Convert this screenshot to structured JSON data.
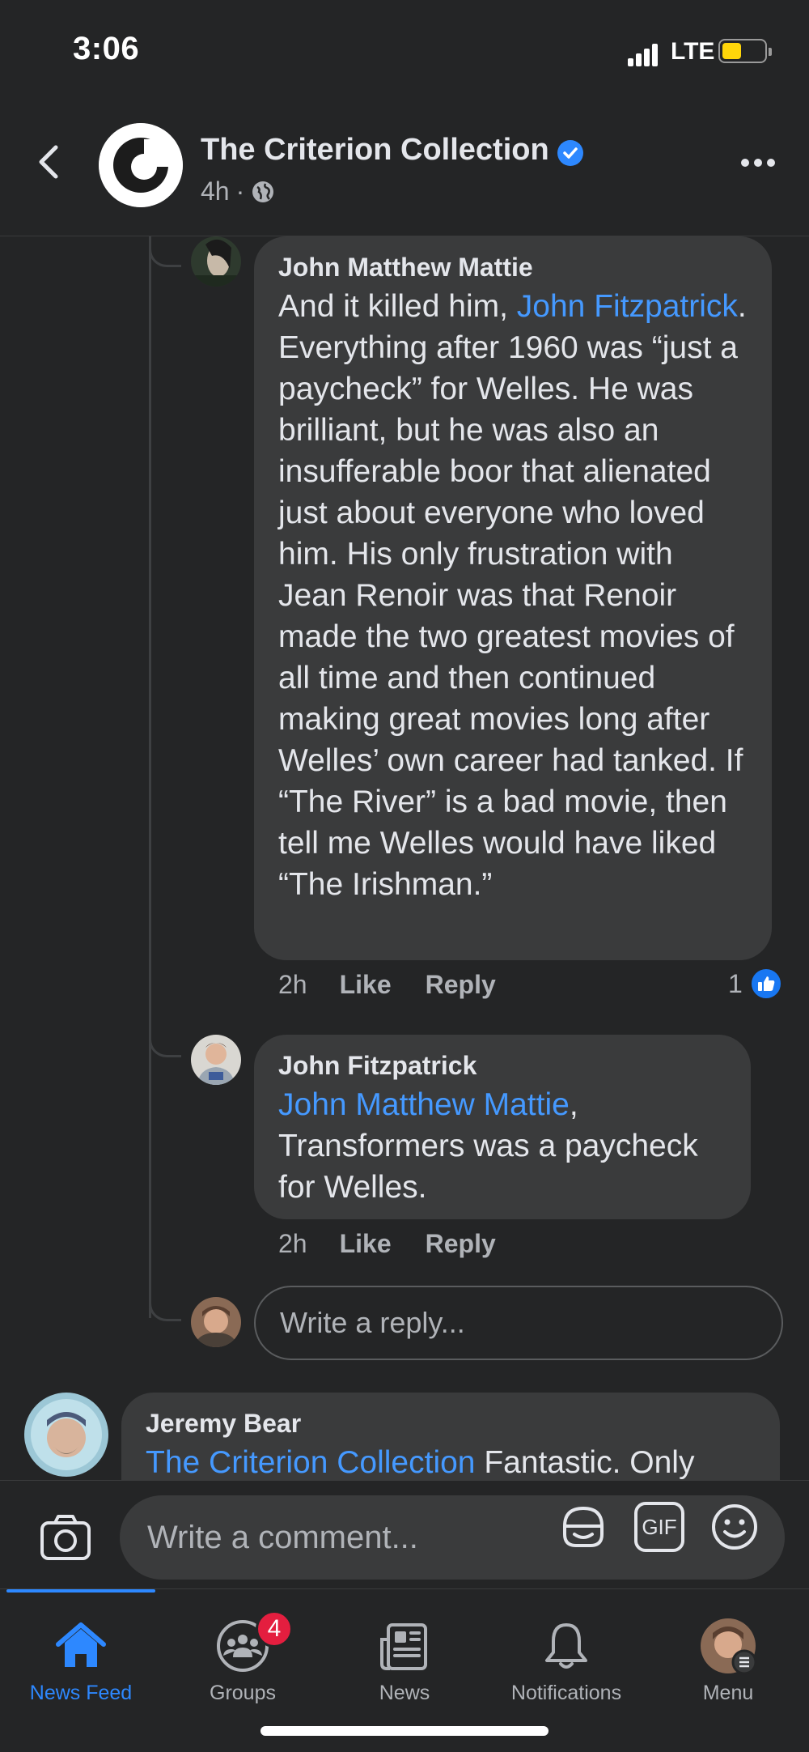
{
  "status_bar": {
    "time": "3:06",
    "network": "LTE",
    "battery_color": "#ffd60a"
  },
  "header": {
    "page_name": "The Criterion Collection",
    "time_ago": "4h",
    "separator": "·",
    "verified_icon": "verified-check-icon",
    "privacy_icon": "globe-icon"
  },
  "comments": [
    {
      "author": "John Matthew Mattie",
      "body_pre": "And it killed him, ",
      "mention": "John Fitzpatrick",
      "body_post": ". Everything after 1960 was “just a paycheck” for Welles. He was brilliant, but he was also an insufferable boor that alienated just about everyone who loved him. His only frustration with Jean Renoir was that Renoir made the two greatest movies of all time and then continued making great movies long after Welles’ own career had tanked. If “The River” is a bad movie, then tell me Welles would have liked “The Irishman.”",
      "time": "2h",
      "like_label": "Like",
      "reply_label": "Reply",
      "reaction_count": "1"
    },
    {
      "author": "John Fitzpatrick",
      "mention": "John Matthew Mattie",
      "body_post": ", Transformers was a paycheck for Welles.",
      "time": "2h",
      "like_label": "Like",
      "reply_label": "Reply"
    }
  ],
  "reply_input": {
    "placeholder": "Write a reply..."
  },
  "next_comment": {
    "author": "Jeremy Bear",
    "mention": "The Criterion Collection",
    "body_post": " Fantastic. Only"
  },
  "composer": {
    "placeholder": "Write a comment...",
    "gif_label": "GIF"
  },
  "tabs": [
    {
      "label": "News Feed",
      "icon": "home-icon",
      "active": true
    },
    {
      "label": "Groups",
      "icon": "groups-icon",
      "badge": "4"
    },
    {
      "label": "News",
      "icon": "news-icon"
    },
    {
      "label": "Notifications",
      "icon": "bell-icon"
    },
    {
      "label": "Menu",
      "icon": "profile-menu-icon"
    }
  ],
  "colors": {
    "background": "#242526",
    "bubble": "#3a3b3c",
    "link": "#4599ff",
    "accent": "#2d88ff",
    "badge": "#e41e3f"
  }
}
